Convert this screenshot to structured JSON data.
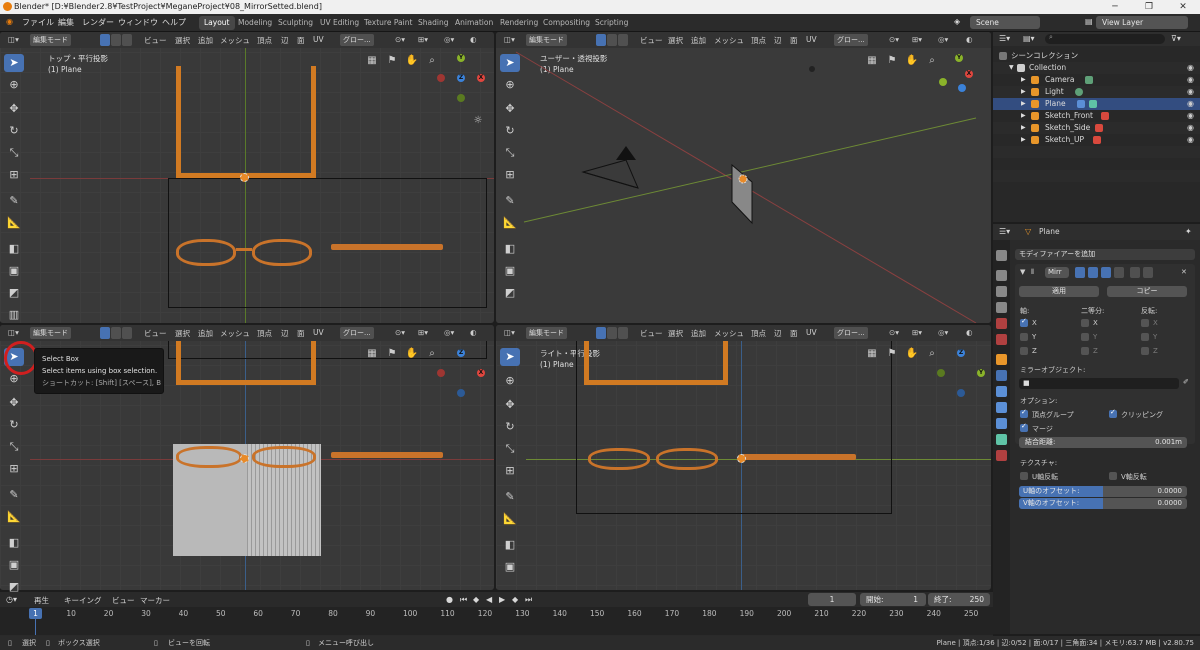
{
  "window": {
    "title": "Blender* [D:¥Blender2.8¥TestProject¥MeganeProject¥08_MirrorSetted.blend]",
    "controls": [
      "─",
      "❐",
      "✕"
    ]
  },
  "menu": [
    "ファイル",
    "編集",
    "レンダー",
    "ウィンドウ",
    "ヘルプ"
  ],
  "workspaces": [
    "Layout",
    "Modeling",
    "Sculpting",
    "UV Editing",
    "Texture Paint",
    "Shading",
    "Animation",
    "Rendering",
    "Compositing",
    "Scripting"
  ],
  "active_workspace": "Layout",
  "scene": {
    "label": "Scene"
  },
  "view_layer": {
    "label": "View Layer"
  },
  "viewport_header": {
    "mode": "編集モード",
    "view": "ビュー",
    "select": "選択",
    "add": "追加",
    "mesh": "メッシュ",
    "vertex": "頂点",
    "edge": "辺",
    "face": "面",
    "uv": "UV",
    "transform": "グロー..."
  },
  "viewports": {
    "top_left": {
      "title": "トップ・平行投影",
      "object": "(1) Plane"
    },
    "top_right": {
      "title": "ユーザー・透視投影",
      "object": "(1) Plane"
    },
    "bottom_left": {
      "title": "",
      "object": ""
    },
    "bottom_right": {
      "title": "ライト・平行投影",
      "object": "(1) Plane"
    }
  },
  "tooltip": {
    "title": "Select Box",
    "description": "Select items using box selection.",
    "shortcut": "ショートカット: [Shift] [スペース], B"
  },
  "gizmo": {
    "x": "X",
    "y": "Y",
    "z": "Z"
  },
  "outliner": {
    "root": "シーンコレクション",
    "items": [
      {
        "name": "Collection",
        "indent": 0
      },
      {
        "name": "Camera",
        "indent": 1
      },
      {
        "name": "Light",
        "indent": 1
      },
      {
        "name": "Plane",
        "indent": 1,
        "selected": true
      },
      {
        "name": "Sketch_Front",
        "indent": 1
      },
      {
        "name": "Sketch_Side",
        "indent": 1
      },
      {
        "name": "Sketch_UP",
        "indent": 1
      }
    ]
  },
  "properties": {
    "object_name": "Plane",
    "add_modifier": "モディファイアーを追加",
    "modifier_name": "Mirr",
    "apply": "適用",
    "copy": "コピー",
    "axis_label": "軸:",
    "bisect_label": "二等分:",
    "flip_label": "反転:",
    "axes": [
      "X",
      "Y",
      "Z"
    ],
    "axis_checked": [
      true,
      false,
      false
    ],
    "mirror_object": "ミラーオブジェクト:",
    "options": "オプション:",
    "vertex_groups": "頂点グループ",
    "clipping": "クリッピング",
    "merge": "マージ",
    "merge_distance_label": "結合距離:",
    "merge_distance_value": "0.001m",
    "textures": "テクスチャ:",
    "u_flip": "U軸反転",
    "v_flip": "V軸反転",
    "u_offset_label": "U軸のオフセット:",
    "u_offset_value": "0.0000",
    "v_offset_label": "V軸のオフセット:",
    "v_offset_value": "0.0000"
  },
  "timeline": {
    "playback": "再生",
    "keying": "キーイング",
    "view": "ビュー",
    "marker": "マーカー",
    "current_frame": "1",
    "start_label": "開始:",
    "start_value": "1",
    "end_label": "終了:",
    "end_value": "250",
    "ticks": [
      "10",
      "20",
      "30",
      "40",
      "50",
      "60",
      "70",
      "80",
      "90",
      "100",
      "110",
      "120",
      "130",
      "140",
      "150",
      "160",
      "170",
      "180",
      "190",
      "200",
      "210",
      "220",
      "230",
      "240",
      "250"
    ]
  },
  "status": {
    "select": "選択",
    "box_select": "ボックス選択",
    "rotate_view": "ビューを回転",
    "call_menu": "メニュー呼び出し",
    "stats": "Plane | 頂点:1/36 | 辺:0/52 | 面:0/17 | 三角面:34 | メモリ:63.7 MB | v2.80.75"
  }
}
